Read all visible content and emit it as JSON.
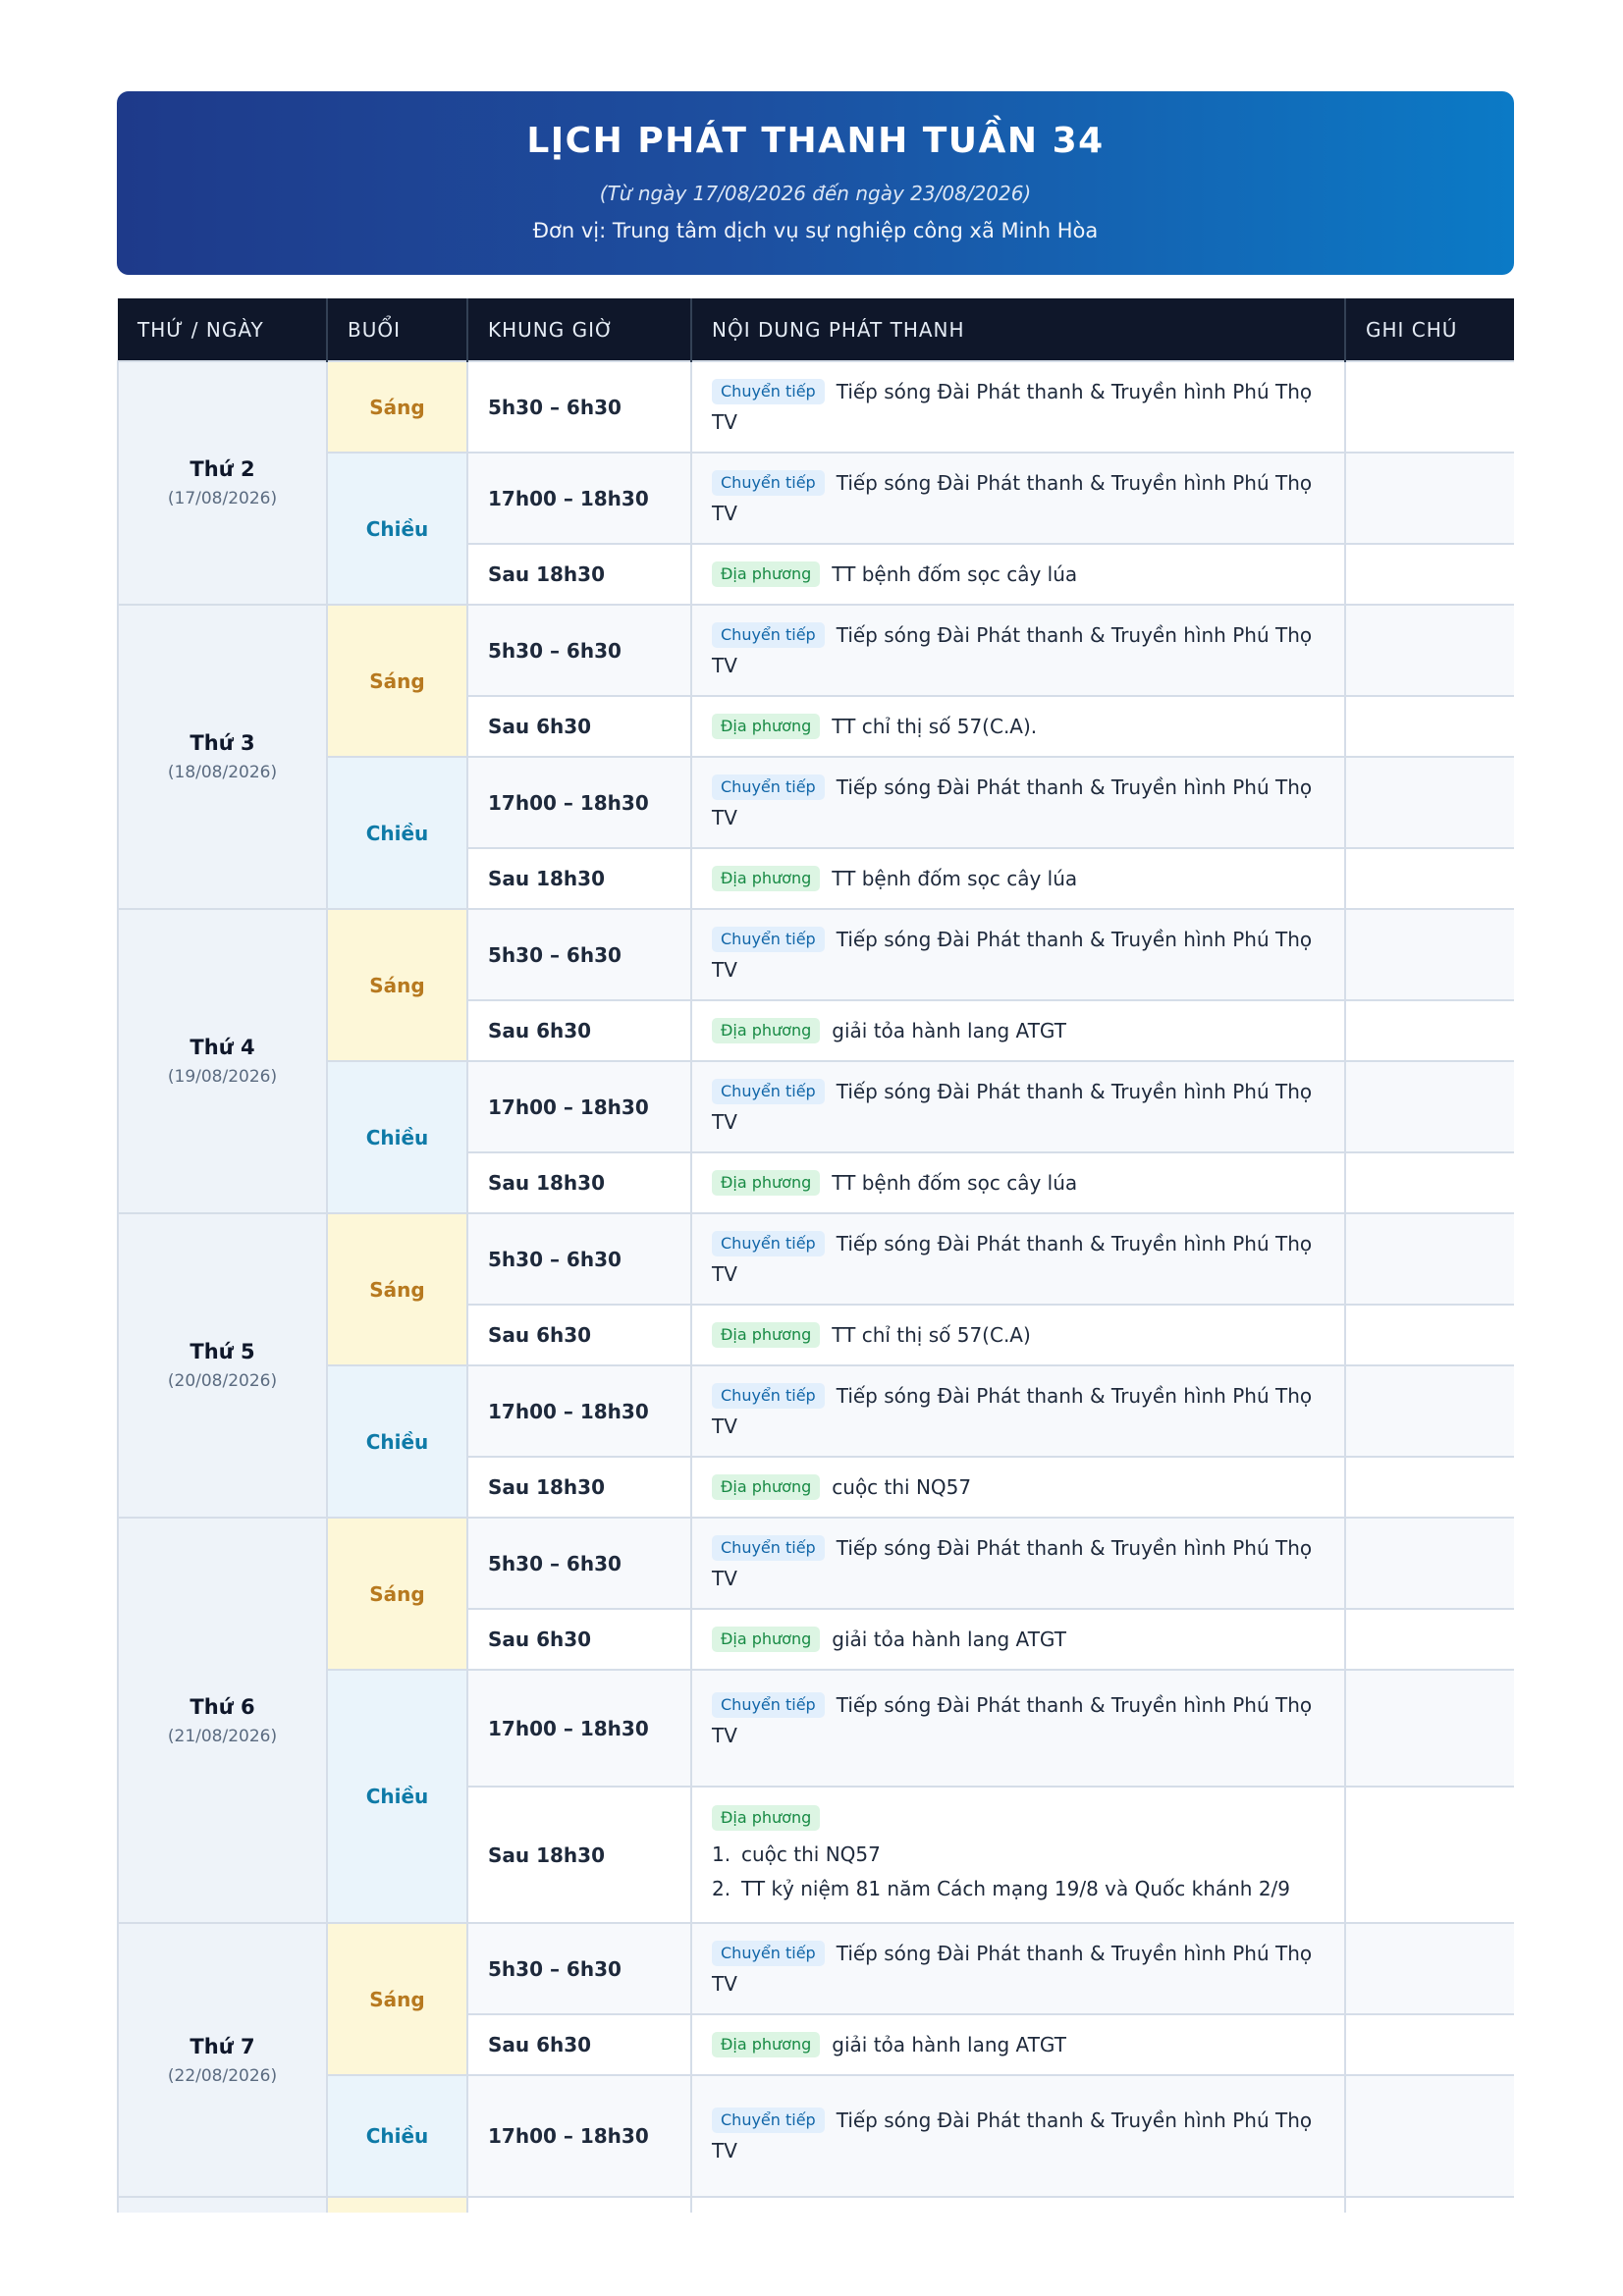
{
  "header": {
    "title": "LỊCH PHÁT THANH TUẦN 34",
    "subtitle": "(Từ ngày 17/08/2026 đến ngày 23/08/2026)",
    "unit": "Đơn vị: Trung tâm dịch vụ sự nghiệp công xã Minh Hòa"
  },
  "columns": {
    "day": "THỨ / NGÀY",
    "session": "BUỔI",
    "time": "KHUNG GIỜ",
    "content": "NỘI DUNG PHÁT THANH",
    "note": "GHI CHÚ"
  },
  "sessions": {
    "morning": "Sáng",
    "afternoon": "Chiều"
  },
  "tags": {
    "relay": "Chuyển tiếp",
    "local": "Địa phương"
  },
  "relay_text": "Tiếp sóng Đài Phát thanh & Truyền hình Phú Thọ TV",
  "times": {
    "morning_main": "5h30 – 6h30",
    "morning_after": "Sau 6h30",
    "afternoon_main": "17h00 – 18h30",
    "afternoon_after": "Sau 18h30"
  },
  "days": [
    {
      "name": "Thứ 2",
      "date": "(17/08/2026)",
      "morning_local": "",
      "evening_local": "TT bệnh đốm sọc cây lúa"
    },
    {
      "name": "Thứ 3",
      "date": "(18/08/2026)",
      "morning_local": "TT chỉ thị số 57(C.A).",
      "evening_local": "TT bệnh đốm sọc cây lúa"
    },
    {
      "name": "Thứ 4",
      "date": "(19/08/2026)",
      "morning_local": "giải tỏa hành lang ATGT",
      "evening_local": "TT bệnh đốm sọc cây lúa"
    },
    {
      "name": "Thứ 5",
      "date": "(20/08/2026)",
      "morning_local": "TT chỉ thị số 57(C.A)",
      "evening_local": "cuộc thi NQ57"
    },
    {
      "name": "Thứ 6",
      "date": "(21/08/2026)",
      "morning_local": "giải tỏa hành lang ATGT",
      "evening_items": [
        "cuộc thi NQ57",
        "TT kỷ niệm 81 năm Cách mạng 19/8 và Quốc khánh 2/9"
      ]
    },
    {
      "name": "Thứ 7",
      "date": "(22/08/2026)",
      "morning_local": "giải tỏa hành lang ATGT"
    }
  ]
}
